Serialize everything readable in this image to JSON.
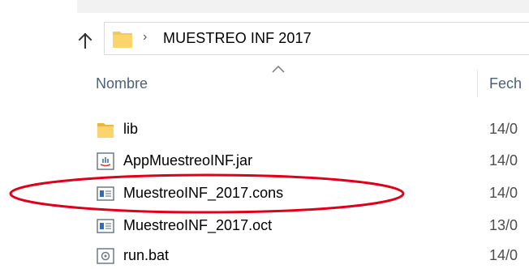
{
  "address_bar": {
    "path": "MUESTREO INF 2017",
    "separator": "›"
  },
  "columns": {
    "name": "Nombre",
    "date": "Fech"
  },
  "files": [
    {
      "name": "lib",
      "date": "14/0",
      "icon": "folder-icon"
    },
    {
      "name": "AppMuestreoINF.jar",
      "date": "14/0",
      "icon": "java-jar-icon"
    },
    {
      "name": "MuestreoINF_2017.cons",
      "date": "14/0",
      "icon": "generic-file-icon"
    },
    {
      "name": "MuestreoINF_2017.oct",
      "date": "13/0",
      "icon": "generic-file-icon"
    },
    {
      "name": "run.bat",
      "date": "14/0",
      "icon": "batch-file-icon"
    }
  ],
  "highlight": {
    "target": "MuestreoINF_2017.cons",
    "color": "#e0001a"
  },
  "colors": {
    "folder": "#f3c85c",
    "header_text": "#4c607a",
    "selection_ring": "#e0001a"
  }
}
